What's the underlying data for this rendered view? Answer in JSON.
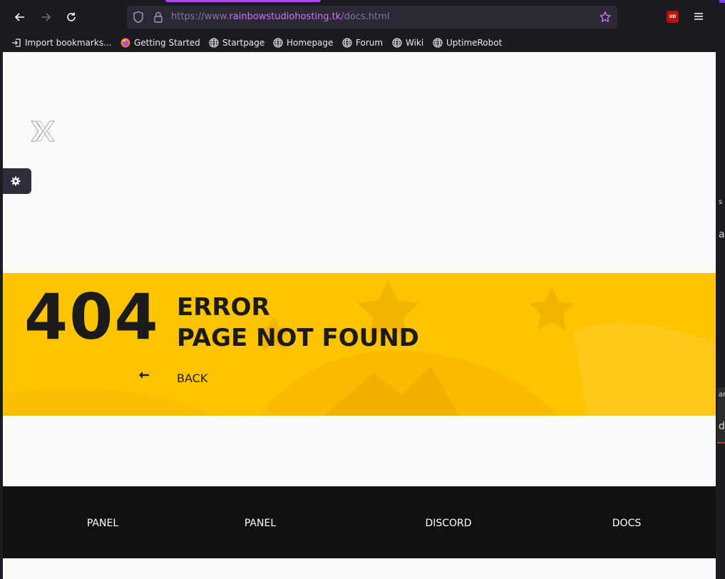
{
  "browser": {
    "url_prefix": "https://www.",
    "url_host": "rainbowstudiohosting.tk",
    "url_path": "/docs.html",
    "extension_badge": "UD"
  },
  "bookmarks": [
    {
      "label": "Import bookmarks...",
      "icon": "import-icon"
    },
    {
      "label": "Getting Started",
      "icon": "firefox-icon"
    },
    {
      "label": "Startpage",
      "icon": "globe-icon"
    },
    {
      "label": "Homepage",
      "icon": "globe-icon"
    },
    {
      "label": "Forum",
      "icon": "globe-icon"
    },
    {
      "label": "Wiki",
      "icon": "globe-icon"
    },
    {
      "label": "UptimeRobot",
      "icon": "globe-icon"
    }
  ],
  "error": {
    "code": "404",
    "line1": "ERROR",
    "line2": "PAGE NOT FOUND",
    "back_label": "BACK"
  },
  "footer": {
    "links": [
      "PANEL",
      "PANEL",
      "DISCORD",
      "DOCS"
    ]
  },
  "edge_fragments": [
    "s",
    "a",
    "ar",
    "de"
  ],
  "colors": {
    "banner": "#ffc400",
    "footer": "#111013",
    "chrome": "#1c1b22",
    "url_host": "#d070ff"
  }
}
